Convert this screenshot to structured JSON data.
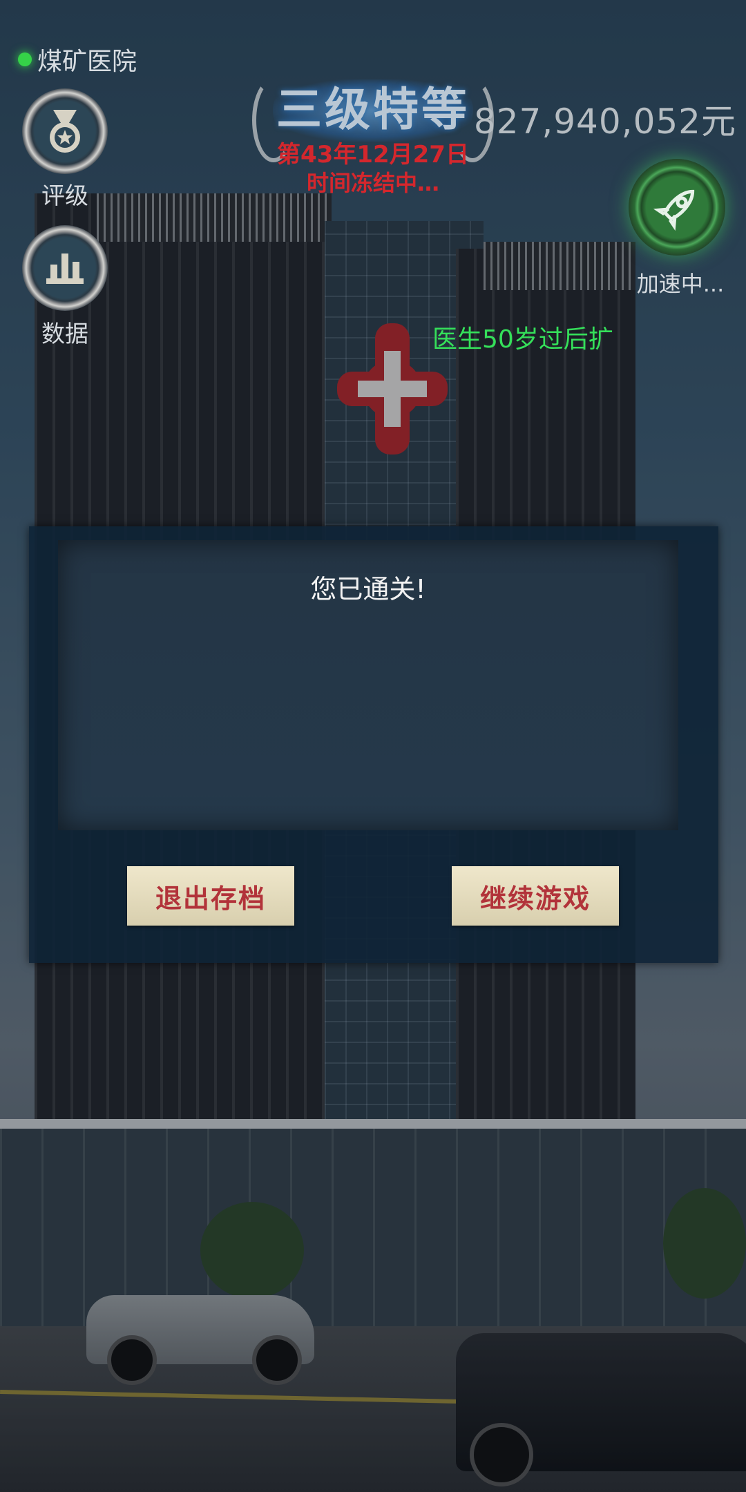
{
  "hud": {
    "hospital_name": "煤矿医院",
    "rank_title": "三级特等",
    "date_text": "第43年12月27日",
    "status_text": "时间冻结中…",
    "money": "827,940,052元",
    "notice": "医生50岁过后扩"
  },
  "sidebar": {
    "rating_label": "评级",
    "rating_icon": "medal-icon",
    "data_label": "数据",
    "data_icon": "bar-chart-icon"
  },
  "speed": {
    "label": "加速中...",
    "icon": "rocket-icon"
  },
  "dialog": {
    "title": "您已通关!",
    "exit_button": "退出存档",
    "continue_button": "继续游戏"
  },
  "colors": {
    "accent_green": "#35e05a",
    "date_red": "#d4272d",
    "button_text": "#b2333a",
    "button_bg": "#efe7cb"
  }
}
